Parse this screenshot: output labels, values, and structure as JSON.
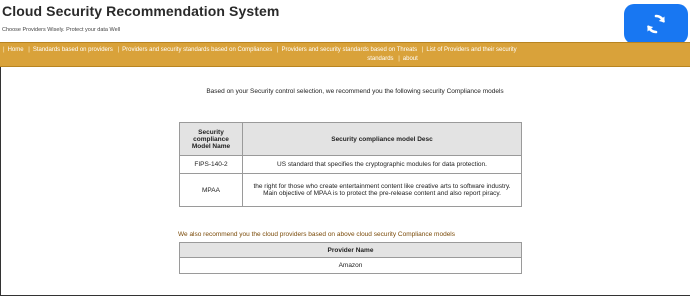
{
  "header": {
    "title": "Cloud Security Recommendation System",
    "tagline": "Choose Providers Wisely. Protect your data Well"
  },
  "nav": {
    "items": [
      "Home",
      "Standards based on providers",
      "Providers and security standards based on Compliances",
      "Providers and security standards based on Threats",
      "List of Providers and their security",
      "standards",
      "about"
    ]
  },
  "content": {
    "intro": "Based on your Security control selection, we recommend you the following security Compliance models",
    "compliance_table": {
      "headers": [
        "Security compliance Model Name",
        "Security compliance model Desc"
      ],
      "rows": [
        [
          "FIPS-140-2",
          "US standard that specifies the cryptographic modules for data protection."
        ],
        [
          "MPAA",
          "the right for those who create entertainment content like creative arts to software industry. Main objective of MPAA is to protect the pre-release content and also report piracy."
        ]
      ]
    },
    "providers_intro": "We also recommend you the cloud providers based on above cloud security Compliance models",
    "providers_table": {
      "header": "Provider Name",
      "rows": [
        "Amazon"
      ]
    }
  },
  "colors": {
    "nav_bg": "#d9a23a",
    "sync_button": "#1877f2"
  },
  "icons": {
    "sync": "sync-icon"
  }
}
